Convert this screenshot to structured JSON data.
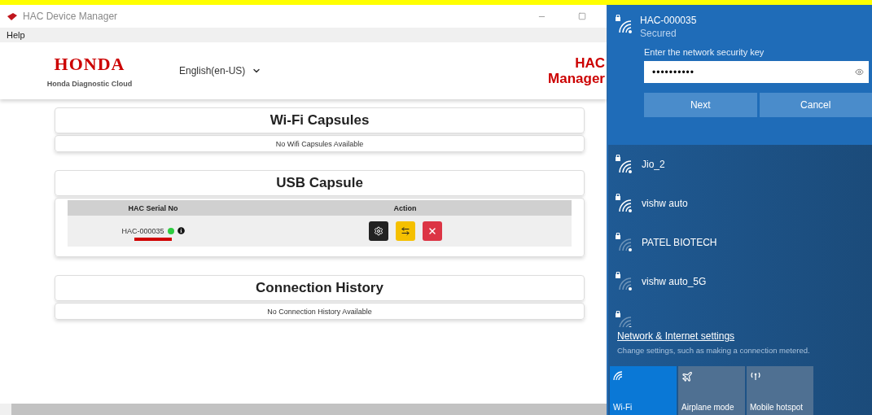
{
  "window": {
    "title": "HAC Device Manager",
    "menu": [
      "Help"
    ]
  },
  "header": {
    "brand": "HONDA",
    "tagline": "Honda Diagnostic Cloud",
    "language": "English(en-US)",
    "product": [
      "HAC",
      "Manager"
    ]
  },
  "wifi_capsules": {
    "title": "Wi-Fi Capsules",
    "empty": "No Wifi Capsules Available"
  },
  "usb_capsule": {
    "title": "USB Capsule",
    "columns": [
      "HAC Serial No",
      "Action"
    ],
    "rows": [
      {
        "serial": "HAC-000035",
        "color": "#2ecc40",
        "actions": [
          {
            "kind": "settings"
          },
          {
            "kind": "swap"
          },
          {
            "kind": "remove"
          }
        ]
      }
    ]
  },
  "connection_history": {
    "title": "Connection History",
    "empty": "No Connection History Available"
  },
  "network_flyout": {
    "selected": {
      "ssid": "HAC-000035",
      "status": "Secured",
      "prompt": "Enter the network security key",
      "value": "••••••••••",
      "buttons": [
        "Next",
        "Cancel"
      ]
    },
    "networks": [
      {
        "ssid": "Jio_2",
        "kind": "strong"
      },
      {
        "ssid": "vishw auto",
        "kind": "strong"
      },
      {
        "ssid": "PATEL BIOTECH",
        "kind": "weak"
      },
      {
        "ssid": "vishw auto_5G",
        "kind": "weak"
      },
      {
        "kind": "weak"
      }
    ],
    "settings_link": "Network & Internet settings",
    "settings_hint": "Change settings, such as making a connection metered.",
    "tiles": [
      {
        "label": "Wi-Fi",
        "kind": "wifi",
        "on": true
      },
      {
        "label": "Airplane mode",
        "kind": "airplane",
        "on": false
      },
      {
        "label": "Mobile hotspot",
        "kind": "hotspot",
        "on": false
      }
    ]
  }
}
